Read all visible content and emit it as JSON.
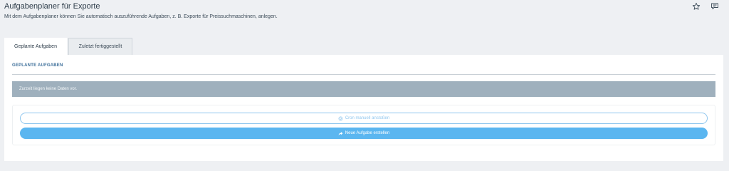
{
  "header": {
    "title": "Aufgabenplaner für Exporte",
    "description": "Mit dem Aufgabenplaner können Sie automatisch auszuführende Aufgaben, z. B. Exporte für Preissuchmaschinen, anlegen.",
    "icons": [
      "star-icon",
      "chat-icon"
    ]
  },
  "tabs": [
    {
      "label": "Geplante Aufgaben",
      "active": true
    },
    {
      "label": "Zuletzt fertiggestellt",
      "active": false
    }
  ],
  "panel": {
    "section_title": "GEPLANTE AUFGABEN",
    "empty_message": "Zurzeit liegen keine Daten vor.",
    "buttons": {
      "cron_label": "Cron manuell anstoßen",
      "cron_icon": "gear-icon",
      "new_task_label": "Neue Aufgabe erstellen",
      "new_task_icon": "share-arrow-icon"
    }
  },
  "colors": {
    "accent": "#5bb6f0",
    "empty_bar": "#9fb0bd",
    "section_title": "#3d6f9a"
  }
}
